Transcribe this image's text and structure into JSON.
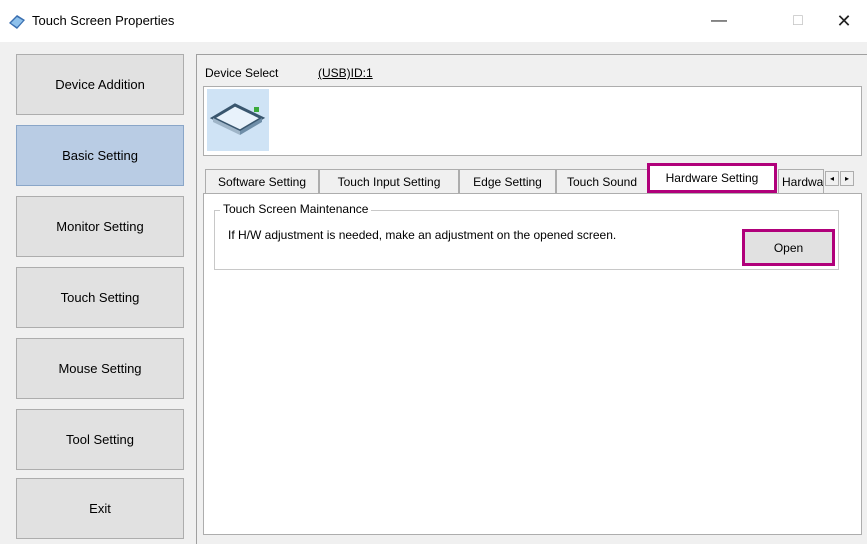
{
  "window": {
    "title": "Touch Screen Properties",
    "controls": {
      "minimize": "—",
      "maximize": "□",
      "close": "✕"
    }
  },
  "sidebar": {
    "items": [
      {
        "label": "Device Addition",
        "selected": false
      },
      {
        "label": "Basic Setting",
        "selected": true
      },
      {
        "label": "Monitor Setting",
        "selected": false
      },
      {
        "label": "Touch Setting",
        "selected": false
      },
      {
        "label": "Mouse Setting",
        "selected": false
      },
      {
        "label": "Tool Setting",
        "selected": false
      },
      {
        "label": "Exit",
        "selected": false
      }
    ]
  },
  "device": {
    "select_label": "Device Select",
    "selected_device": "(USB)ID:1"
  },
  "tabs": {
    "items": [
      {
        "label": "Software Setting"
      },
      {
        "label": "Touch Input Setting"
      },
      {
        "label": "Edge Setting"
      },
      {
        "label": "Touch Sound"
      },
      {
        "label": "Hardware Setting",
        "active": true
      },
      {
        "label": "Hardwa"
      }
    ],
    "scroll_left": "◂",
    "scroll_right": "▸"
  },
  "maintenance": {
    "title": "Touch Screen Maintenance",
    "description": "If H/W adjustment is needed, make an adjustment on the opened screen.",
    "open_label": "Open"
  },
  "colors": {
    "highlight": "#b0007a",
    "selected_nav": "#b9cce4"
  }
}
